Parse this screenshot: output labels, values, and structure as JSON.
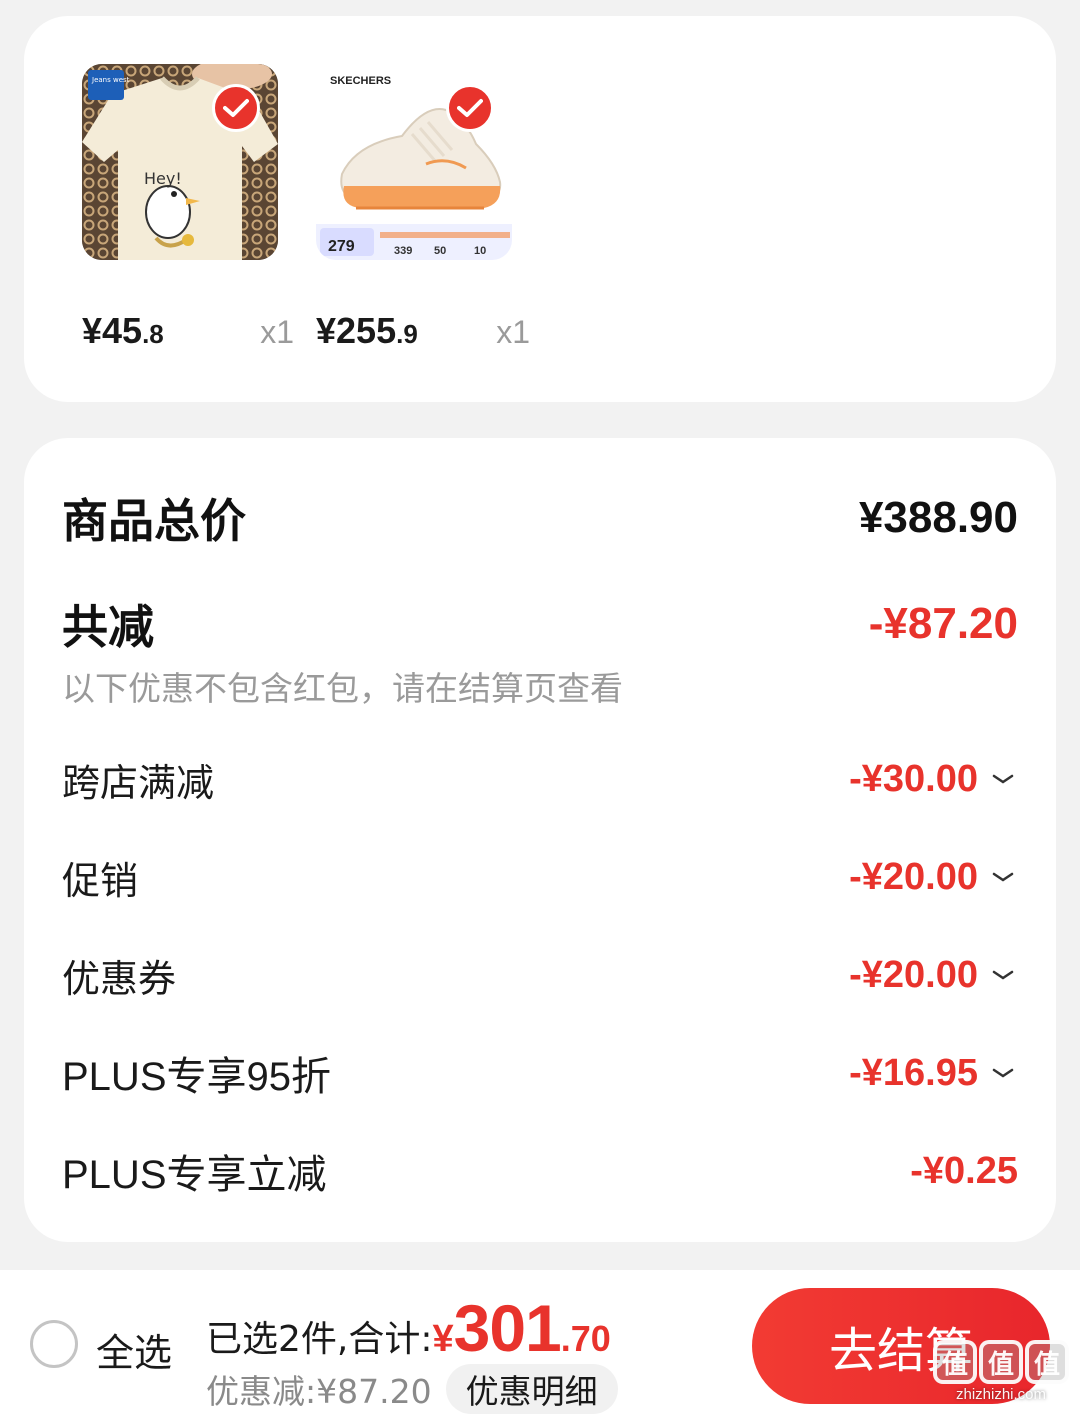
{
  "products": [
    {
      "name": "tee",
      "price_int": "¥45",
      "price_dec": ".8",
      "qty": "x1",
      "brand_badge": "Jeans west",
      "shirt_text": "Hey!",
      "checked": true
    },
    {
      "name": "shoe",
      "price_int": "¥255",
      "price_dec": ".9",
      "qty": "x1",
      "brand": "SKECHERS",
      "promo_price": "279",
      "promo_values": [
        "339",
        "50",
        "10"
      ],
      "checked": true
    }
  ],
  "summary": {
    "total_label": "商品总价",
    "total_value": "¥388.90",
    "reduce_label": "共减",
    "reduce_value": "-¥87.20",
    "note": "以下优惠不包含红包，请在结算页查看",
    "items": [
      {
        "label": "跨店满减",
        "value": "-¥30.00",
        "expandable": true
      },
      {
        "label": "促销",
        "value": "-¥20.00",
        "expandable": true
      },
      {
        "label": "优惠券",
        "value": "-¥20.00",
        "expandable": true
      },
      {
        "label": "PLUS专享95折",
        "value": "-¥16.95",
        "expandable": true
      },
      {
        "label": "PLUS专享立减",
        "value": "-¥0.25",
        "expandable": false
      }
    ]
  },
  "bottom": {
    "select_all": "全选",
    "selected_text": "已选2件,合计:",
    "total_yen": "¥",
    "total_int": "301",
    "total_dec": ".70",
    "discount_text": "优惠减:¥87.20",
    "detail_button": "优惠明细",
    "checkout_button": "去结算"
  },
  "watermark": {
    "chars": [
      "值",
      "值",
      "值"
    ],
    "url": "zhizhizhi.com"
  },
  "colors": {
    "accent_red": "#e8332c",
    "background": "#f2f2f2",
    "card": "#ffffff",
    "muted_text": "#9a9a9a"
  },
  "icons": {
    "check": "check-circle-icon",
    "chevron": "chevron-down-icon",
    "radio": "radio-unchecked-icon"
  }
}
